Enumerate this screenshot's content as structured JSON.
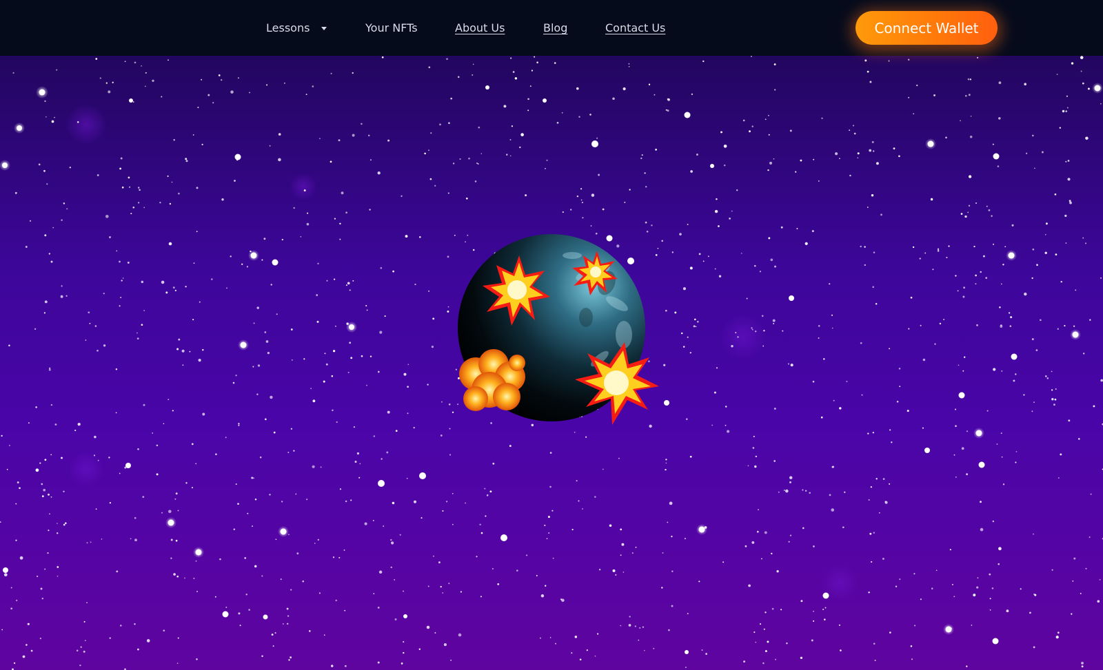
{
  "nav": {
    "items": [
      {
        "label": "Lessons",
        "has_dropdown": true,
        "underlined": false
      },
      {
        "label": "Your NFTs",
        "has_dropdown": false,
        "underlined": false
      },
      {
        "label": "About Us",
        "has_dropdown": false,
        "underlined": true
      },
      {
        "label": "Blog",
        "has_dropdown": false,
        "underlined": true
      },
      {
        "label": "Contact Us",
        "has_dropdown": false,
        "underlined": true
      }
    ],
    "dropdown_icon": "caret-down-icon"
  },
  "connect_wallet": {
    "label": "Connect Wallet",
    "color": "#ff7a0a"
  },
  "hero": {
    "illustration": "planet-with-explosions",
    "background_colors": [
      "#22065f",
      "#4a05a8",
      "#5f049f"
    ],
    "star_color": "#ffffff"
  }
}
